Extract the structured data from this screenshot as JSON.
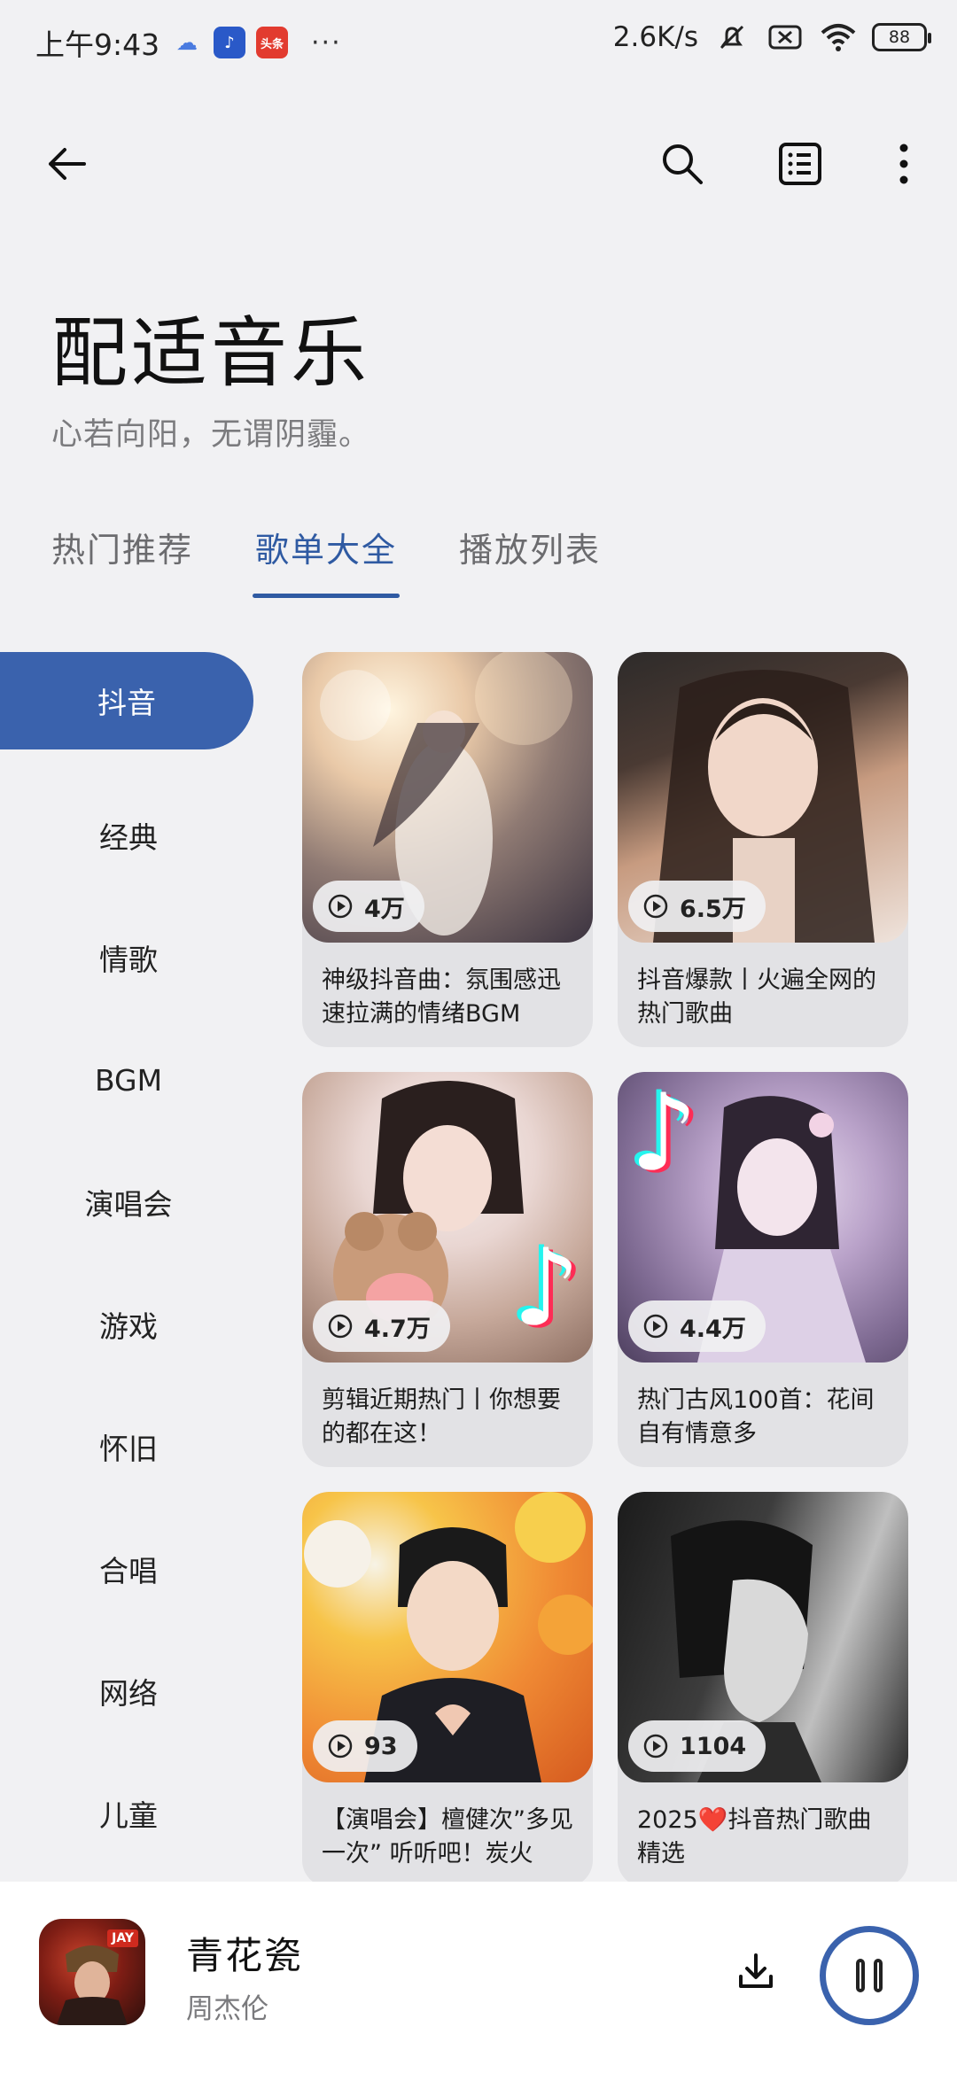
{
  "status_bar": {
    "time": "上午9:43",
    "news_app_label": "头条",
    "more": "···",
    "net_speed": "2.6K/s",
    "battery": "88",
    "icons": [
      "cloud-icon",
      "music-app-icon",
      "news-app-icon",
      "mute-bell-icon",
      "sim-off-icon",
      "wifi-icon",
      "battery-icon"
    ]
  },
  "app_bar": {
    "icons": [
      "back-arrow-icon",
      "search-icon",
      "list-icon",
      "more-vertical-icon"
    ]
  },
  "header": {
    "title": "配适音乐",
    "subtitle": "心若向阳，无谓阴霾。"
  },
  "tabs": [
    {
      "label": "热门推荐",
      "active": false
    },
    {
      "label": "歌单大全",
      "active": true
    },
    {
      "label": "播放列表",
      "active": false
    }
  ],
  "categories": [
    {
      "label": "抖音",
      "active": true
    },
    {
      "label": "经典",
      "active": false
    },
    {
      "label": "情歌",
      "active": false
    },
    {
      "label": "BGM",
      "active": false
    },
    {
      "label": "演唱会",
      "active": false
    },
    {
      "label": "游戏",
      "active": false
    },
    {
      "label": "怀旧",
      "active": false
    },
    {
      "label": "合唱",
      "active": false
    },
    {
      "label": "网络",
      "active": false
    },
    {
      "label": "儿童",
      "active": false
    }
  ],
  "playlists": [
    {
      "plays": "4万",
      "title": "神级抖音曲：氛围感迅速拉满的情绪BGM"
    },
    {
      "plays": "6.5万",
      "title": "抖音爆款丨火遍全网的热门歌曲"
    },
    {
      "plays": "4.7万",
      "title": "剪辑近期热门丨你想要的都在这！"
    },
    {
      "plays": "4.4万",
      "title": "热门古风100首：花间自有情意多"
    },
    {
      "plays": "93",
      "title": "【演唱会】檀健次”多见一次” 听听吧！炭火"
    },
    {
      "plays": "1104",
      "title": "2025❤️抖音热门歌曲精选"
    }
  ],
  "now_playing": {
    "title": "青花瓷",
    "artist": "周杰伦",
    "album_tag": "JAY"
  },
  "colors": {
    "accent": "#3a62ad",
    "background": "#f1f1f3",
    "card": "#e2e2e5"
  }
}
